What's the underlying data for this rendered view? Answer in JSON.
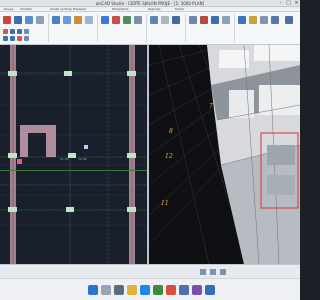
{
  "window": {
    "title": "alsCAD Studio - CERTE SJALON PROJE - [1: 3000 PLAN]"
  },
  "tabs": [
    {
      "label": "Dosya"
    },
    {
      "label": "Yönetim"
    },
    {
      "label": "Analiz ve Proje Hesaplar"
    },
    {
      "label": "Modelleme"
    },
    {
      "label": "Raporlar"
    },
    {
      "label": "Modül"
    }
  ],
  "left_view": {
    "markers": [
      "11.30",
      "11.30"
    ]
  },
  "right_view": {
    "levels": [
      "7",
      "8",
      "12",
      "11"
    ]
  },
  "status": {
    "text": ""
  },
  "taskbar": {
    "time": "",
    "date": ""
  }
}
